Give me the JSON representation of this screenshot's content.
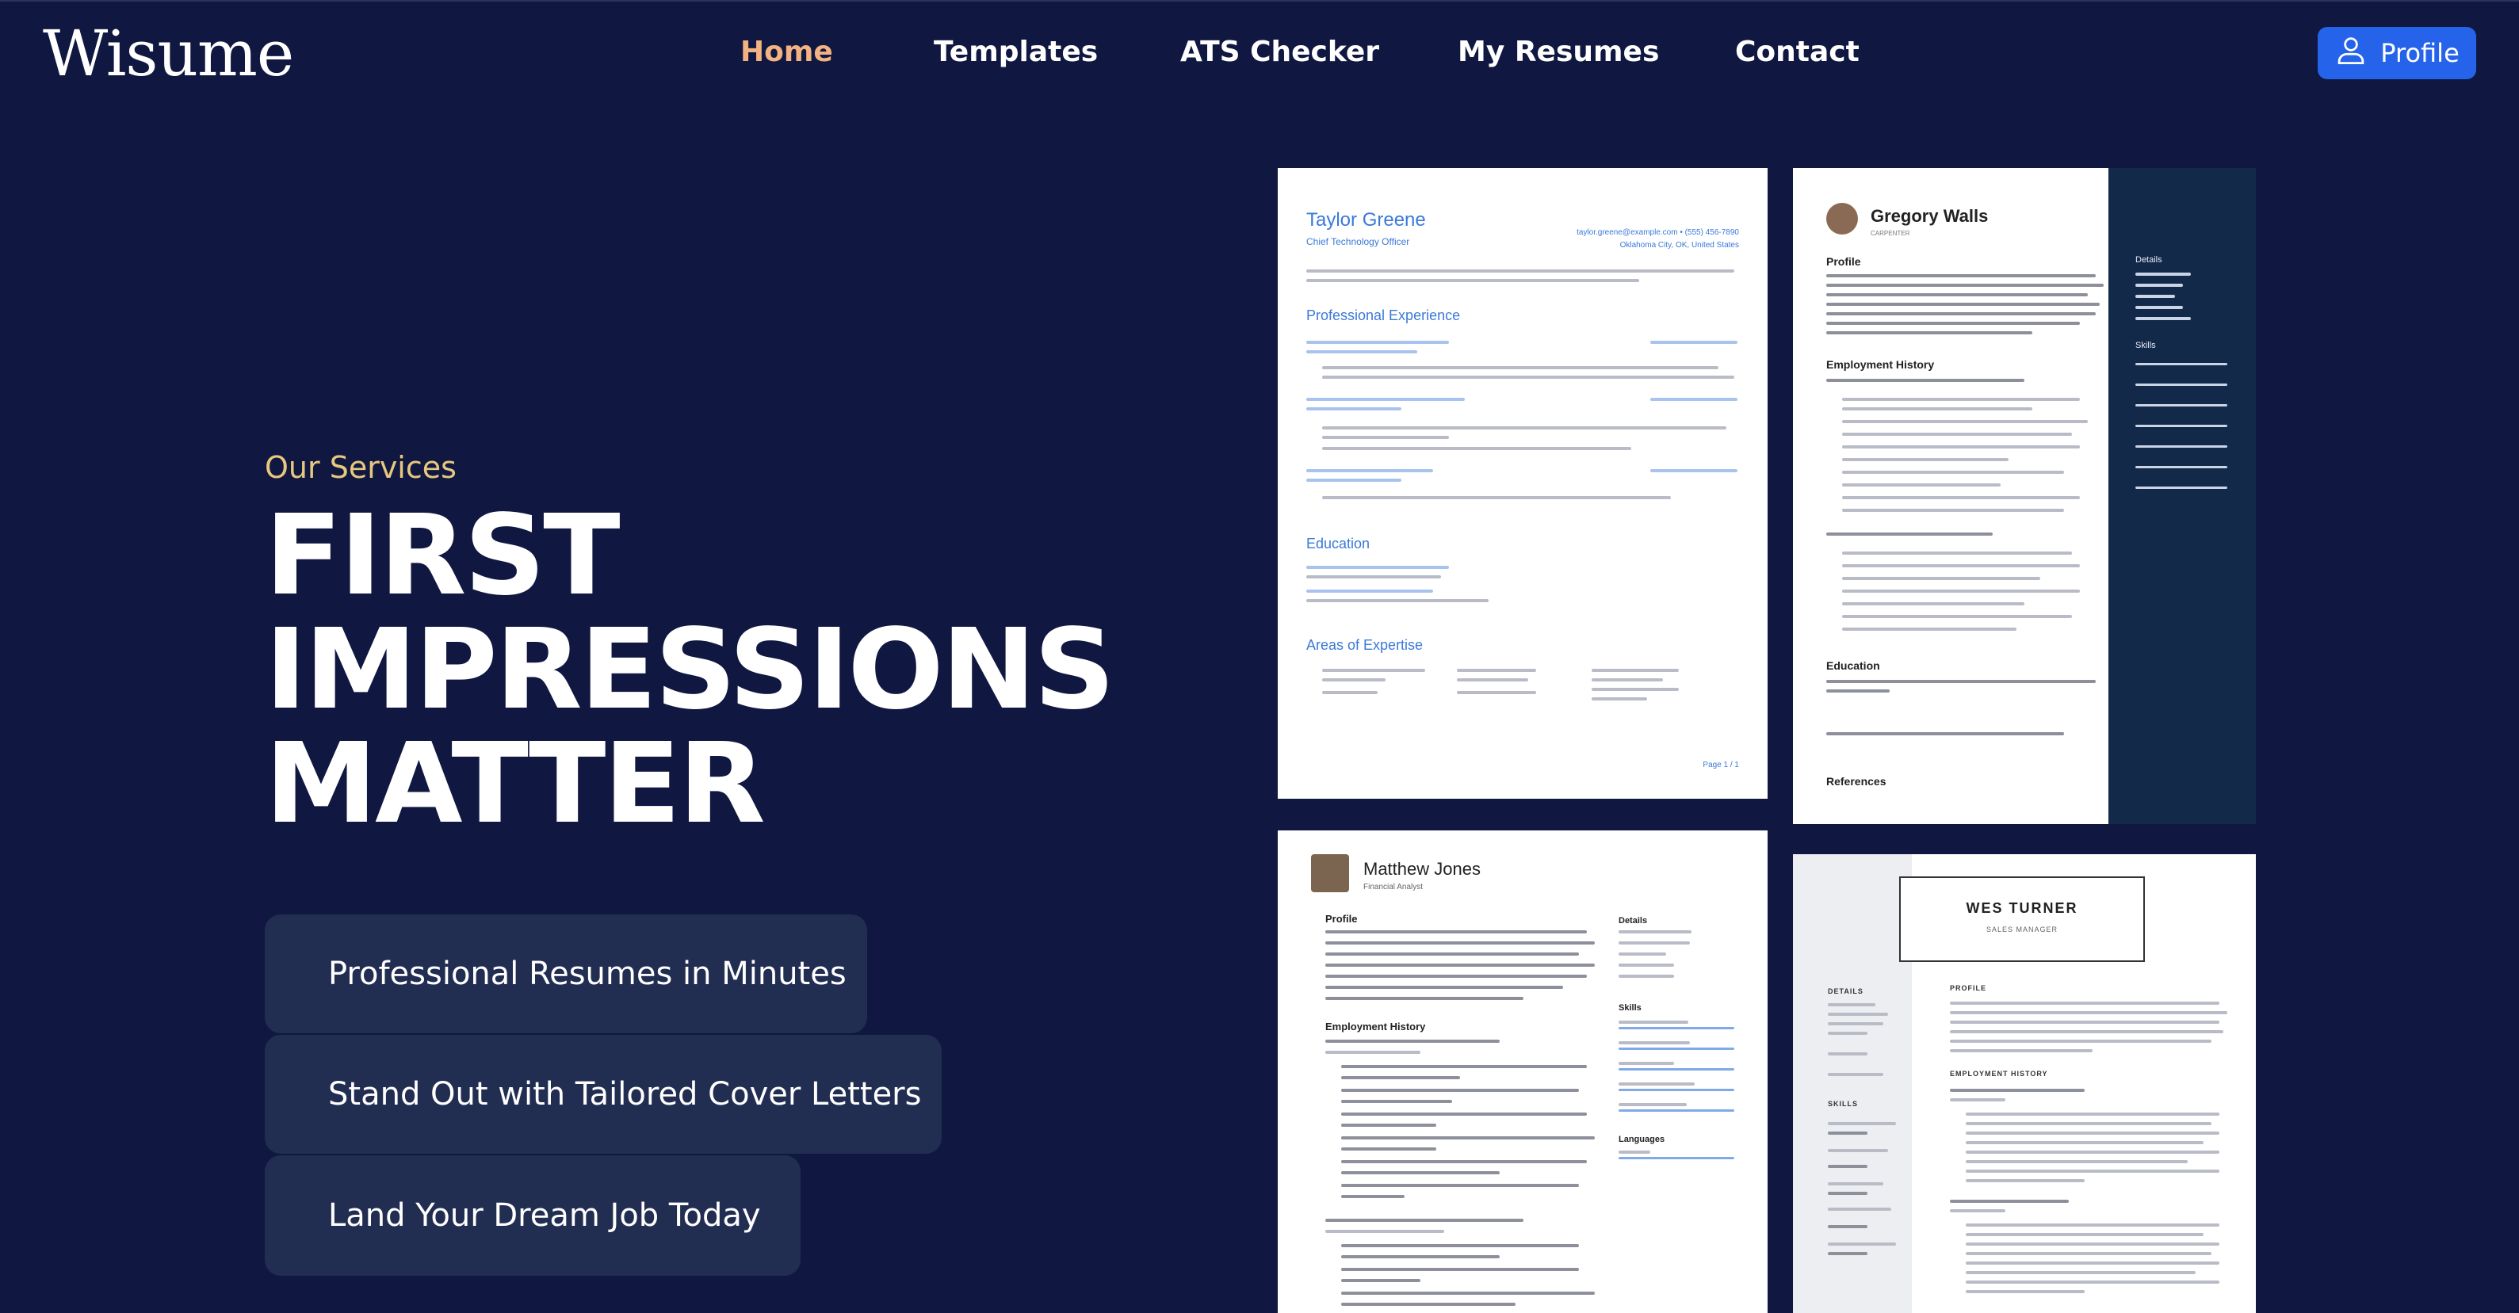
{
  "brand": {
    "logo": "Wisume"
  },
  "nav": {
    "items": [
      {
        "label": "Home",
        "active": true
      },
      {
        "label": "Templates"
      },
      {
        "label": "ATS Checker"
      },
      {
        "label": "My Resumes"
      },
      {
        "label": "Contact"
      }
    ],
    "profile_label": "Profile",
    "profile_icon": "user-icon",
    "accent": "#2563eb",
    "active_color": "#f2b282"
  },
  "hero": {
    "eyebrow": "Our Services",
    "headline": [
      "First",
      "Impressions",
      "Matter"
    ],
    "features": [
      "Professional Resumes in Minutes",
      "Stand Out with Tailored Cover Letters",
      "Land Your Dream Job Today"
    ]
  },
  "resumes": [
    {
      "name": "Taylor Greene",
      "role": "Chief Technology Officer",
      "contact": "taylor.greene@example.com • (555) 456-7890",
      "location": "Oklahoma City, OK, United States",
      "sections": [
        "Professional Experience",
        "Education",
        "Areas of Expertise"
      ],
      "page": "Page 1 / 1"
    },
    {
      "name": "Gregory Walls",
      "role": "CARPENTER",
      "sections": [
        "Profile",
        "Employment History",
        "Education",
        "References"
      ],
      "sidebar": [
        "Details",
        "Skills"
      ]
    },
    {
      "name": "Matthew Jones",
      "role": "Financial Analyst",
      "sections": [
        "Profile",
        "Employment History"
      ],
      "sidebar": [
        "Details",
        "Skills",
        "Languages"
      ]
    },
    {
      "name": "WES TURNER",
      "role": "SALES MANAGER",
      "sections": [
        "PROFILE",
        "EMPLOYMENT HISTORY"
      ],
      "sidebar": [
        "DETAILS",
        "SKILLS"
      ]
    }
  ]
}
